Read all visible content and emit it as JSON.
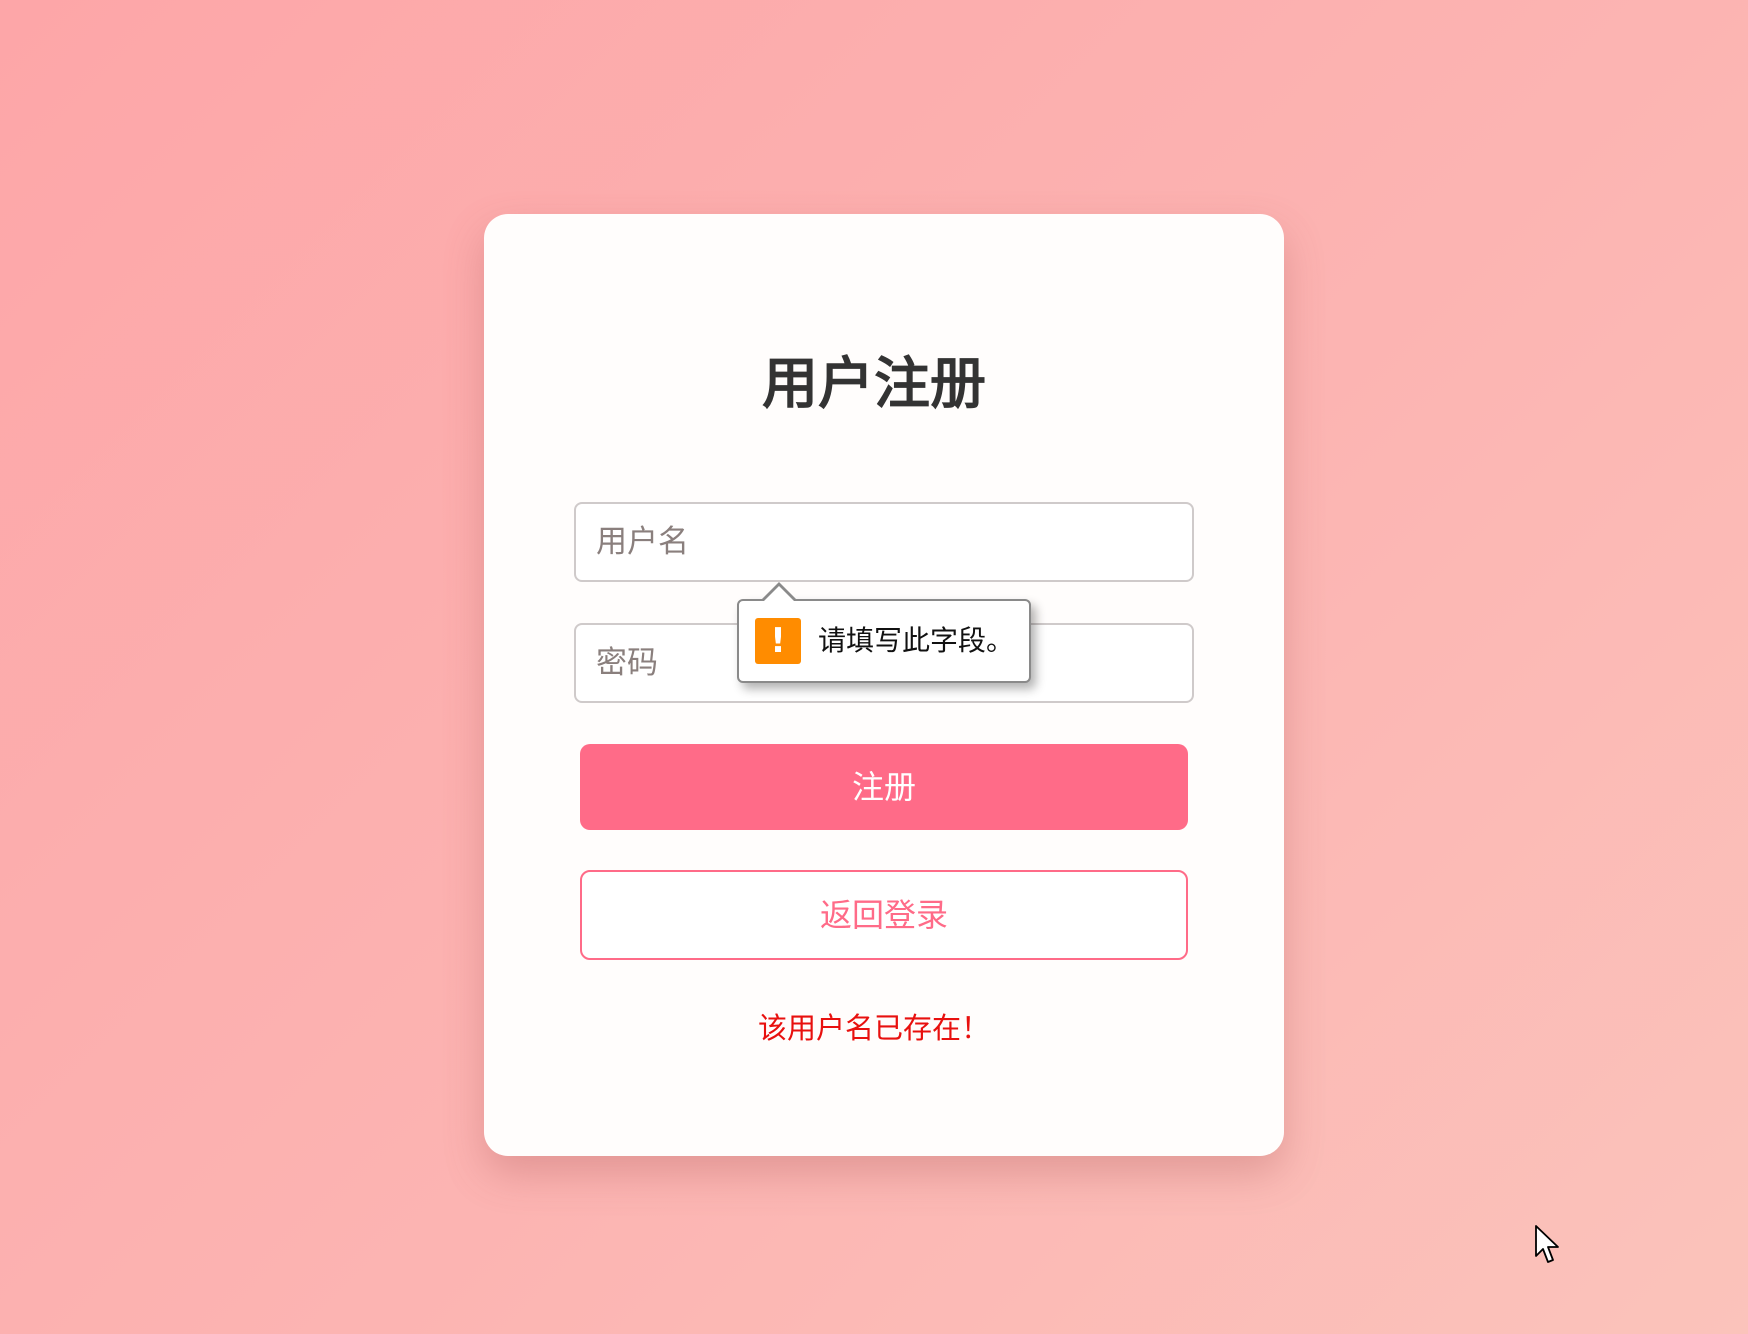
{
  "form": {
    "title": "用户注册",
    "username_placeholder": "用户名",
    "password_placeholder": "密码",
    "register_label": "注册",
    "back_label": "返回登录",
    "error_message": "该用户名已存在！"
  },
  "validation_tooltip": {
    "icon": "warning-icon",
    "icon_glyph": "!",
    "message": "请填写此字段。"
  },
  "colors": {
    "accent": "#ff6b88",
    "error": "#e8100e",
    "warning": "#ff8c00",
    "title": "#333333"
  }
}
